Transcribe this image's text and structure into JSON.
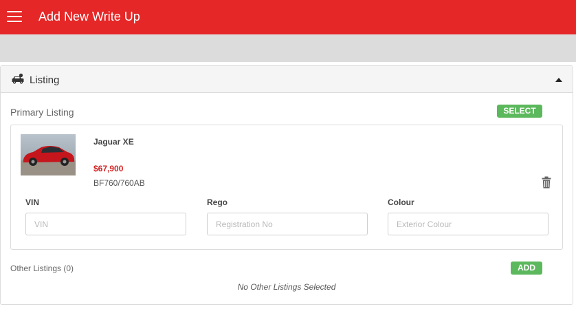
{
  "header": {
    "title": "Add New Write Up",
    "menu_icon": "hamburger-menu-icon",
    "color": "#e52727"
  },
  "listing_panel": {
    "title": "Listing",
    "icon": "car-icon",
    "collapse_icon": "caret-up-icon",
    "primary": {
      "label": "Primary Listing",
      "select_label": "SELECT",
      "item": {
        "name": "Jaguar XE",
        "price": "$67,900",
        "code": "BF760/760AB",
        "thumbnail": "red Jaguar XE car photo"
      },
      "fields": [
        {
          "label": "VIN",
          "placeholder": "VIN",
          "value": ""
        },
        {
          "label": "Rego",
          "placeholder": "Registration No",
          "value": ""
        },
        {
          "label": "Colour",
          "placeholder": "Exterior Colour",
          "value": ""
        }
      ]
    },
    "other": {
      "label": "Other Listings (0)",
      "add_label": "ADD",
      "empty_text": "No Other Listings Selected"
    }
  },
  "colors": {
    "accent_green": "#5cb85c",
    "price_red": "#d32222"
  }
}
